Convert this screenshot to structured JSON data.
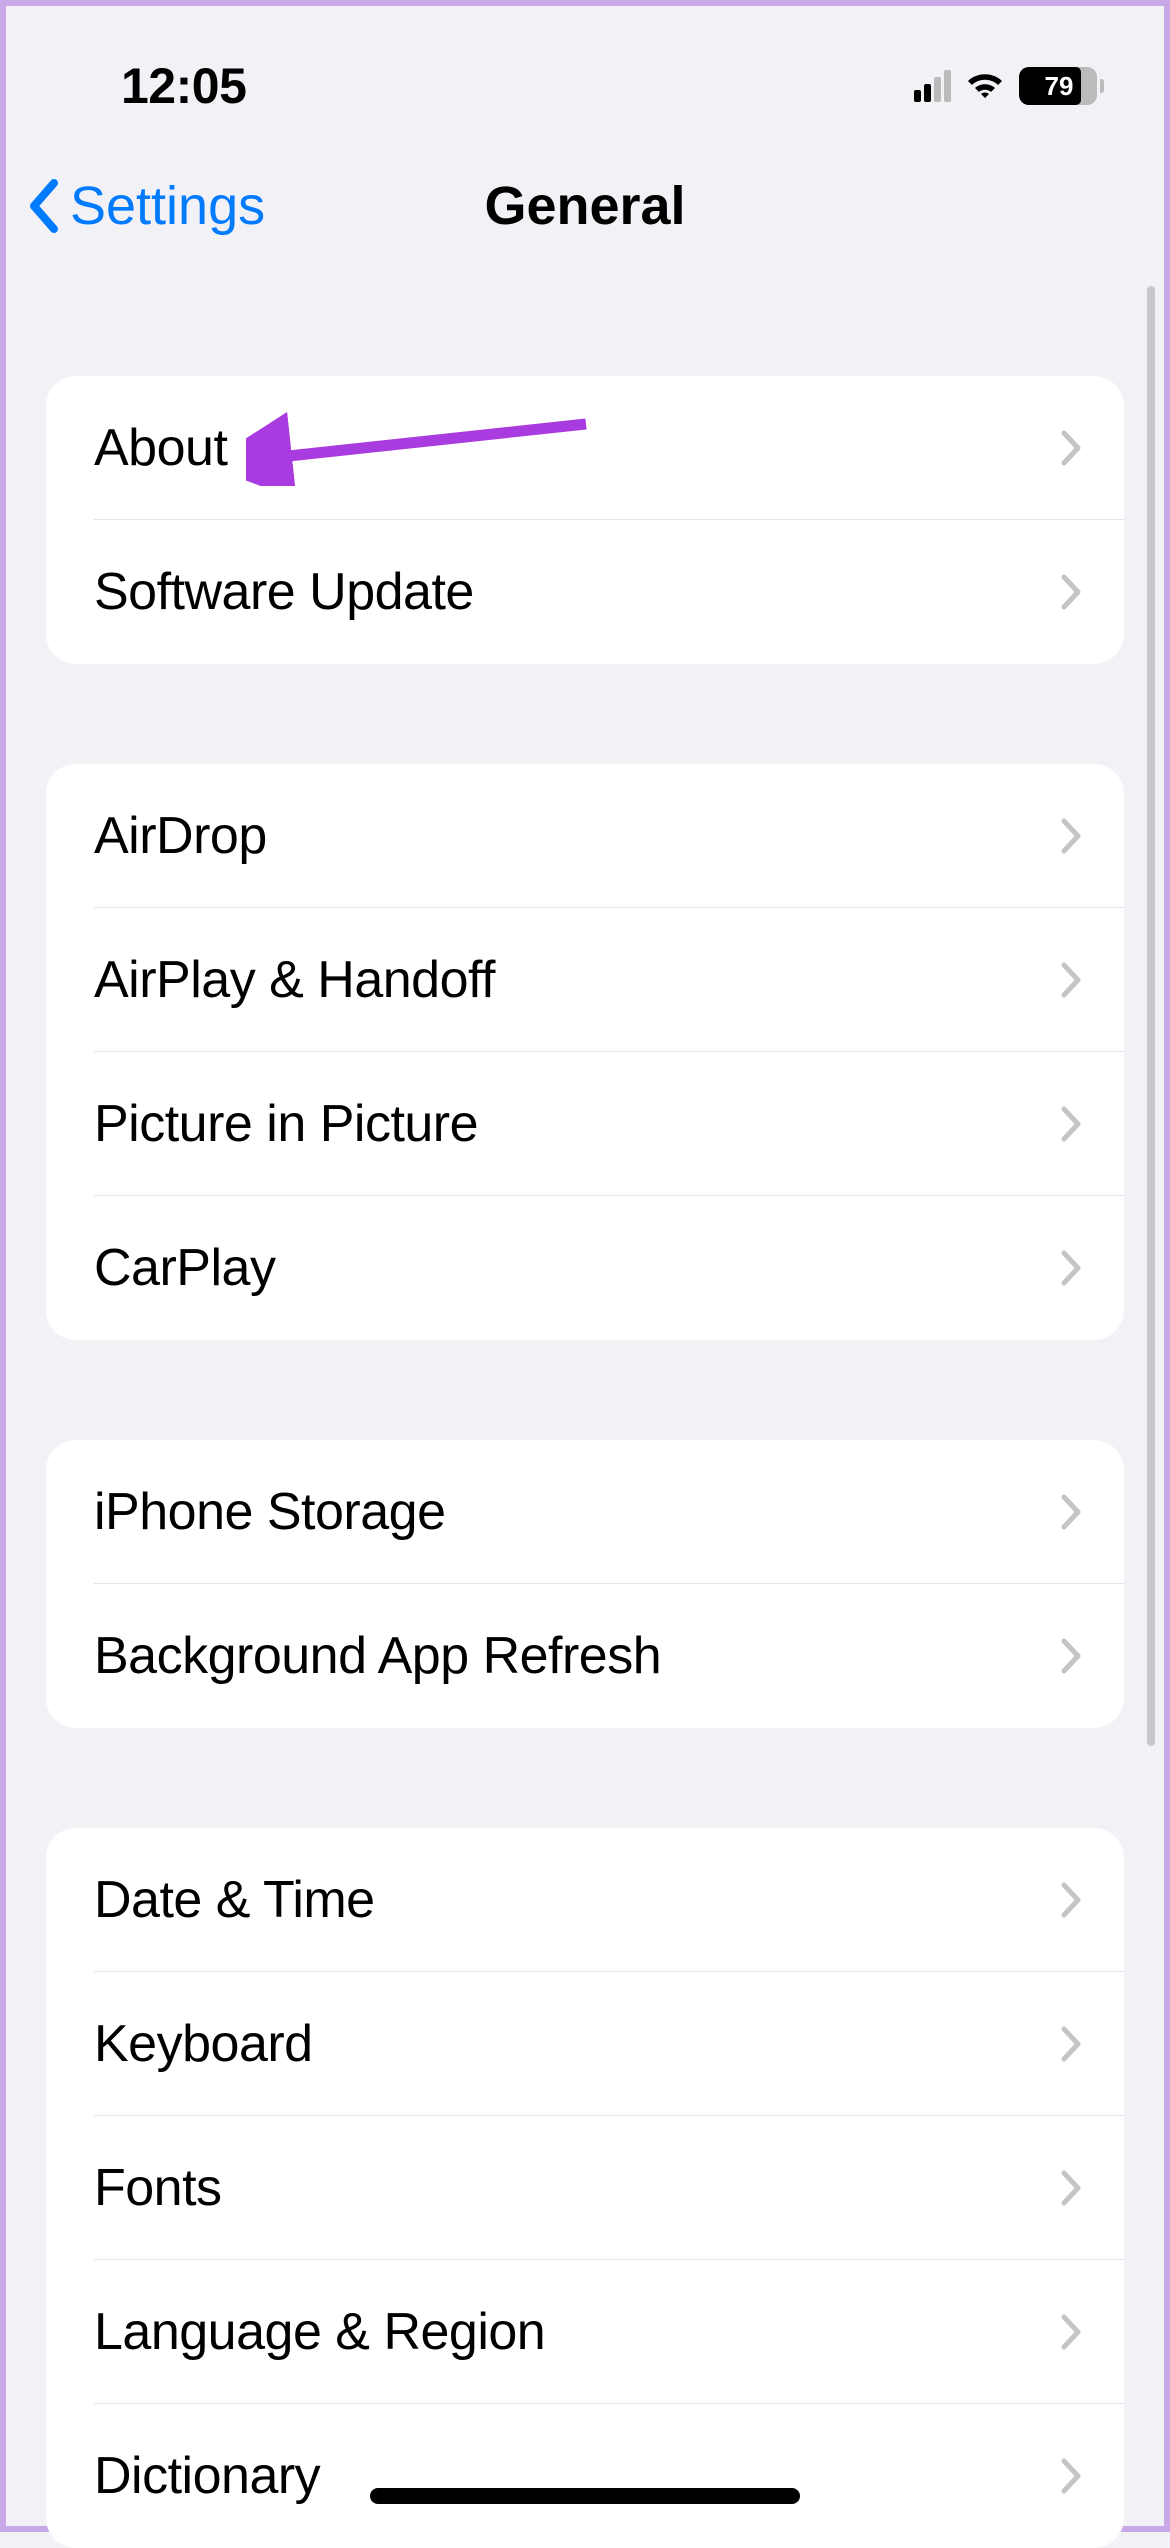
{
  "status_bar": {
    "time": "12:05",
    "battery_percent": "79"
  },
  "nav": {
    "back_label": "Settings",
    "title": "General"
  },
  "groups": [
    {
      "rows": [
        {
          "label": "About"
        },
        {
          "label": "Software Update"
        }
      ]
    },
    {
      "rows": [
        {
          "label": "AirDrop"
        },
        {
          "label": "AirPlay & Handoff"
        },
        {
          "label": "Picture in Picture"
        },
        {
          "label": "CarPlay"
        }
      ]
    },
    {
      "rows": [
        {
          "label": "iPhone Storage"
        },
        {
          "label": "Background App Refresh"
        }
      ]
    },
    {
      "rows": [
        {
          "label": "Date & Time"
        },
        {
          "label": "Keyboard"
        },
        {
          "label": "Fonts"
        },
        {
          "label": "Language & Region"
        },
        {
          "label": "Dictionary"
        }
      ]
    }
  ],
  "annotation": {
    "arrow_color": "#a93ce0"
  }
}
